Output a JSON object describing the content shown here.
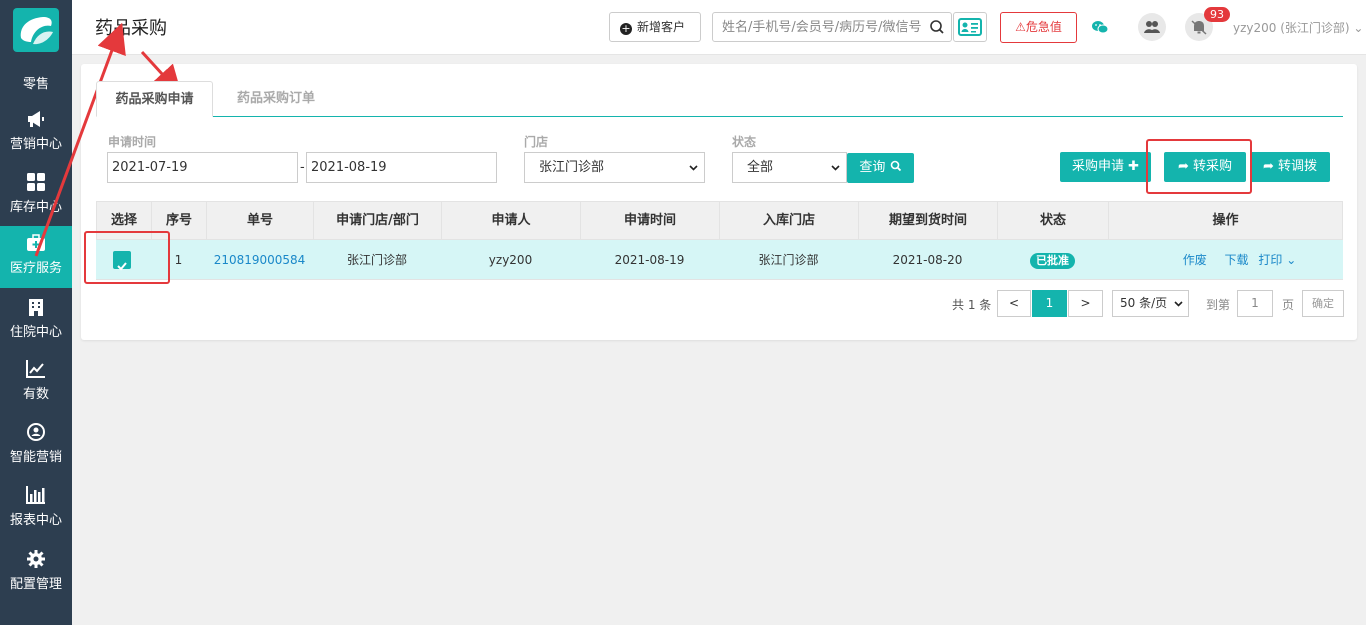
{
  "sidebar": {
    "items": [
      {
        "label": "零售",
        "icon": "retail-icon"
      },
      {
        "label": "营销中心",
        "icon": "megaphone-icon"
      },
      {
        "label": "库存中心",
        "icon": "grid-icon"
      },
      {
        "label": "医疗服务",
        "icon": "medical-kit-icon",
        "active": true
      },
      {
        "label": "住院中心",
        "icon": "hospital-icon"
      },
      {
        "label": "有数",
        "icon": "trend-chart-icon"
      },
      {
        "label": "智能营销",
        "icon": "smart-marketing-icon"
      },
      {
        "label": "报表中心",
        "icon": "bar-chart-icon"
      },
      {
        "label": "配置管理",
        "icon": "gear-icon"
      }
    ]
  },
  "header": {
    "title": "药品采购",
    "add_customer_label": "新增客户",
    "search_placeholder": "姓名/手机号/会员号/病历号/微信号",
    "danger_label": "危急值",
    "notification_count": "93",
    "user": "yzy200 (张江门诊部)"
  },
  "tabs": [
    {
      "label": "药品采购申请",
      "active": true
    },
    {
      "label": "药品采购订单",
      "active": false
    }
  ],
  "filters": {
    "date_label": "申请时间",
    "date_from": "2021-07-19",
    "date_sep": "-",
    "date_to": "2021-08-19",
    "store_label": "门店",
    "store_value": "张江门诊部",
    "status_label": "状态",
    "status_value": "全部",
    "query_label": "查询"
  },
  "actions": {
    "apply_label": "采购申请",
    "to_purchase_label": "转采购",
    "to_transfer_label": "转调拨"
  },
  "table": {
    "headers": [
      "选择",
      "序号",
      "单号",
      "申请门店/部门",
      "申请人",
      "申请时间",
      "入库门店",
      "期望到货时间",
      "状态",
      "操作"
    ],
    "rows": [
      {
        "index": "1",
        "order_no": "210819000584",
        "dept": "张江门诊部",
        "applicant": "yzy200",
        "apply_date": "2021-08-19",
        "warehouse": "张江门诊部",
        "expected_date": "2021-08-20",
        "status": "已批准",
        "op_void": "作废",
        "op_download": "下载",
        "op_print": "打印"
      }
    ]
  },
  "pagination": {
    "total": "共 1 条",
    "prev": "<",
    "current": "1",
    "next": ">",
    "page_size": "50 条/页",
    "goto_label": "到第",
    "goto_value": "1",
    "page_suffix": "页",
    "confirm": "确定"
  },
  "colors": {
    "accent": "#14b4ad",
    "sidebar": "#2d3e50",
    "danger": "#e4393c",
    "link": "#1a88c9"
  }
}
